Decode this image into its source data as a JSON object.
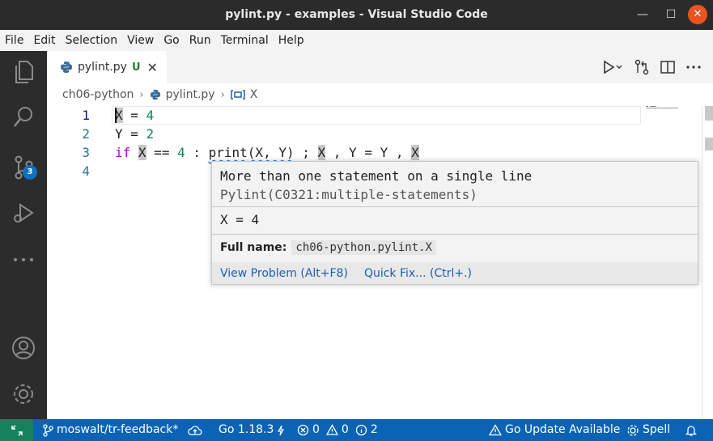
{
  "window": {
    "title": "pylint.py - examples - Visual Studio Code",
    "minimize": "—",
    "maximize": "☐",
    "close": "✕"
  },
  "menu": [
    "File",
    "Edit",
    "Selection",
    "View",
    "Go",
    "Run",
    "Terminal",
    "Help"
  ],
  "activity_bar": {
    "icons": [
      "explorer-icon",
      "search-icon",
      "source-control-icon",
      "run-debug-icon",
      "more-icon",
      "account-icon",
      "settings-gear-icon"
    ],
    "source_control_badge": "3"
  },
  "tab": {
    "filename": "pylint.py",
    "status": "U",
    "close": "✕"
  },
  "breadcrumb": {
    "folder": "ch06-python",
    "file": "pylint.py",
    "symbol": "X"
  },
  "editor": {
    "line_numbers": [
      "1",
      "2",
      "3",
      "4"
    ],
    "lines": {
      "l1": {
        "a": "X",
        "b": " = ",
        "c": "4"
      },
      "l2": {
        "a": "Y",
        "b": " = ",
        "c": "2"
      },
      "l3": {
        "if": "if",
        "x": "X",
        "eq": " == ",
        "four": "4",
        "colon": " : ",
        "print": "print",
        "args": "(X, Y)",
        "semi": " ; ",
        "x2": "X",
        "comma": " , ",
        "y": "Y",
        "assign": " = ",
        "y2": "Y",
        "comma2": " , ",
        "x3": "X"
      }
    }
  },
  "hover": {
    "message": "More than one statement on a single line",
    "source": "Pylint(C0321:multiple-statements)",
    "code": "X = 4",
    "fullname_label": "Full name:",
    "fullname_value": "ch06-python.pylint.X",
    "action_view": "View Problem (Alt+F8)",
    "action_fix": "Quick Fix... (Ctrl+.)"
  },
  "status_bar": {
    "branch": "moswalt/tr-feedback*",
    "go_version": "Go 1.18.3",
    "errors": "0",
    "warnings": "0",
    "infos": "2",
    "go_update": "Go Update Available",
    "spell": "Spell"
  },
  "colors": {
    "activity_bar": "#2c2c2c",
    "status_bar": "#0a63b5",
    "remote": "#16825d",
    "keyword": "#af00db",
    "number": "#098658"
  }
}
